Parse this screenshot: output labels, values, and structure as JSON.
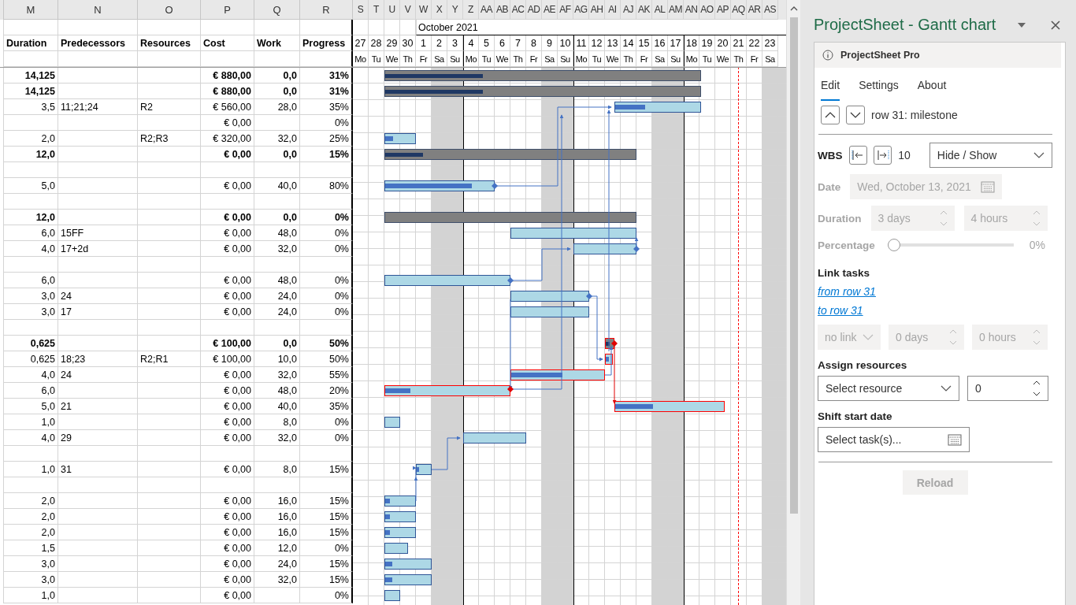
{
  "sheet": {
    "column_letters": [
      "M",
      "N",
      "O",
      "P",
      "Q",
      "R",
      "S",
      "T",
      "U",
      "V",
      "W",
      "X",
      "Y",
      "Z",
      "AA",
      "AB",
      "AC",
      "AD",
      "AE",
      "AF",
      "AG",
      "AH",
      "AI",
      "AJ",
      "AK",
      "AL",
      "AM",
      "AN",
      "AO",
      "AP",
      "AQ",
      "AR",
      "AS"
    ],
    "headers": [
      "Duration",
      "Predecessors",
      "Resources",
      "Cost",
      "Work",
      "Progress"
    ],
    "month": "October 2021",
    "days": [
      {
        "number": "27",
        "weekday": "Mo",
        "weekend": false,
        "today": false
      },
      {
        "number": "28",
        "weekday": "Tu",
        "weekend": false,
        "today": false
      },
      {
        "number": "29",
        "weekday": "We",
        "weekend": false,
        "today": false
      },
      {
        "number": "30",
        "weekday": "Th",
        "weekend": false,
        "today": false
      },
      {
        "number": "1",
        "weekday": "Fr",
        "weekend": false,
        "today": false
      },
      {
        "number": "2",
        "weekday": "Sa",
        "weekend": true,
        "today": false
      },
      {
        "number": "3",
        "weekday": "Su",
        "weekend": true,
        "today": false
      },
      {
        "number": "4",
        "weekday": "Mo",
        "weekend": false,
        "today": false
      },
      {
        "number": "5",
        "weekday": "Tu",
        "weekend": false,
        "today": false
      },
      {
        "number": "6",
        "weekday": "We",
        "weekend": false,
        "today": false
      },
      {
        "number": "7",
        "weekday": "Th",
        "weekend": false,
        "today": false
      },
      {
        "number": "8",
        "weekday": "Fr",
        "weekend": false,
        "today": false
      },
      {
        "number": "9",
        "weekday": "Sa",
        "weekend": true,
        "today": false
      },
      {
        "number": "10",
        "weekday": "Su",
        "weekend": true,
        "today": false
      },
      {
        "number": "11",
        "weekday": "Mo",
        "weekend": false,
        "today": false
      },
      {
        "number": "12",
        "weekday": "Tu",
        "weekend": false,
        "today": false
      },
      {
        "number": "13",
        "weekday": "We",
        "weekend": false,
        "today": false
      },
      {
        "number": "14",
        "weekday": "Th",
        "weekend": false,
        "today": false
      },
      {
        "number": "15",
        "weekday": "Fr",
        "weekend": false,
        "today": false
      },
      {
        "number": "16",
        "weekday": "Sa",
        "weekend": true,
        "today": false
      },
      {
        "number": "17",
        "weekday": "Su",
        "weekend": true,
        "today": false
      },
      {
        "number": "18",
        "weekday": "Mo",
        "weekend": false,
        "today": false
      },
      {
        "number": "19",
        "weekday": "Tu",
        "weekend": false,
        "today": false
      },
      {
        "number": "20",
        "weekday": "We",
        "weekend": false,
        "today": false
      },
      {
        "number": "21",
        "weekday": "Th",
        "weekend": false,
        "today": true
      },
      {
        "number": "22",
        "weekday": "Fr",
        "weekend": false,
        "today": false
      },
      {
        "number": "23",
        "weekday": "Sa",
        "weekend": true,
        "today": false
      }
    ],
    "rows": [
      {
        "duration": "14,125",
        "cost": "€ 880,00",
        "work": "0,0",
        "progress": "31%",
        "bold": true,
        "bar": {
          "kind": "summary",
          "level": 0.31
        }
      },
      {
        "duration": "14,125",
        "cost": "€ 880,00",
        "work": "0,0",
        "progress": "31%",
        "bold": true,
        "bar": {
          "kind": "summary",
          "level": 0.31
        }
      },
      {
        "duration": "3,5",
        "predecessors": "11;21;24",
        "resources": "R2",
        "cost": "€ 560,00",
        "work": "28,0",
        "progress": "35%",
        "bold": false,
        "bar": {
          "kind": "task",
          "level": 0.35
        }
      },
      {
        "cost": "€ 0,00",
        "progress": "0%",
        "bold": false
      },
      {
        "duration": "2,0",
        "resources": "R2;R3",
        "cost": "€ 320,00",
        "work": "32,0",
        "progress": "25%",
        "bold": false,
        "bar": {
          "kind": "task",
          "level": 0.25
        }
      },
      {
        "duration": "12,0",
        "cost": "€ 0,00",
        "work": "0,0",
        "progress": "15%",
        "bold": true,
        "bar": {
          "kind": "summary",
          "level": 0.15
        }
      },
      {},
      {
        "duration": "5,0",
        "cost": "€ 0,00",
        "work": "40,0",
        "progress": "80%",
        "bold": false,
        "bar": {
          "kind": "task",
          "level": 0.8
        }
      },
      {},
      {
        "duration": "12,0",
        "cost": "€ 0,00",
        "work": "0,0",
        "progress": "0%",
        "bold": true,
        "bar": {
          "kind": "summary",
          "level": 0
        }
      },
      {
        "duration": "6,0",
        "predecessors": "15FF",
        "cost": "€ 0,00",
        "work": "48,0",
        "progress": "0%",
        "bold": false,
        "bar": {
          "kind": "task",
          "level": 0
        }
      },
      {
        "duration": "4,0",
        "predecessors": "17+2d",
        "cost": "€ 0,00",
        "work": "32,0",
        "progress": "0%",
        "bold": false,
        "bar": {
          "kind": "task",
          "level": 0
        }
      },
      {},
      {
        "duration": "6,0",
        "cost": "€ 0,00",
        "work": "48,0",
        "progress": "0%",
        "bold": false,
        "bar": {
          "kind": "task",
          "level": 0
        }
      },
      {
        "duration": "3,0",
        "predecessors": "24",
        "cost": "€ 0,00",
        "work": "24,0",
        "progress": "0%",
        "bold": false,
        "bar": {
          "kind": "task",
          "level": 0
        }
      },
      {
        "duration": "3,0",
        "predecessors": "17",
        "cost": "€ 0,00",
        "work": "24,0",
        "progress": "0%",
        "bold": false,
        "bar": {
          "kind": "task",
          "level": 0
        }
      },
      {},
      {
        "duration": "0,625",
        "cost": "€ 100,00",
        "work": "0,0",
        "progress": "50%",
        "bold": true,
        "bar": {
          "kind": "critical-summary",
          "level": 0.5
        }
      },
      {
        "duration": "0,625",
        "predecessors": "18;23",
        "resources": "R2;R1",
        "cost": "€ 100,00",
        "work": "10,0",
        "progress": "50%",
        "bold": false,
        "bar": {
          "kind": "critical",
          "level": 0.5
        }
      },
      {
        "duration": "4,0",
        "predecessors": "24",
        "cost": "€ 0,00",
        "work": "32,0",
        "progress": "55%",
        "bold": false,
        "bar": {
          "kind": "critical",
          "level": 0.55
        }
      },
      {
        "duration": "6,0",
        "cost": "€ 0,00",
        "work": "48,0",
        "progress": "20%",
        "bold": false,
        "bar": {
          "kind": "critical",
          "level": 0.2
        }
      },
      {
        "duration": "5,0",
        "predecessors": "21",
        "cost": "€ 0,00",
        "work": "40,0",
        "progress": "35%",
        "bold": false,
        "bar": {
          "kind": "critical",
          "level": 0.35
        }
      },
      {
        "duration": "1,0",
        "cost": "€ 0,00",
        "work": "8,0",
        "progress": "0%",
        "bold": false,
        "bar": {
          "kind": "task",
          "level": 0
        }
      },
      {
        "duration": "4,0",
        "predecessors": "29",
        "cost": "€ 0,00",
        "work": "32,0",
        "progress": "0%",
        "bold": false,
        "bar": {
          "kind": "task",
          "level": 0
        }
      },
      {},
      {
        "duration": "1,0",
        "predecessors": "31",
        "cost": "€ 0,00",
        "work": "8,0",
        "progress": "15%",
        "bold": false,
        "bar": {
          "kind": "task",
          "level": 0.15
        }
      },
      {},
      {
        "duration": "2,0",
        "cost": "€ 0,00",
        "work": "16,0",
        "progress": "15%",
        "bold": false,
        "bar": {
          "kind": "task",
          "level": 0.15
        }
      },
      {
        "duration": "2,0",
        "cost": "€ 0,00",
        "work": "16,0",
        "progress": "15%",
        "bold": false,
        "bar": {
          "kind": "task",
          "level": 0.15
        }
      },
      {
        "duration": "2,0",
        "cost": "€ 0,00",
        "work": "16,0",
        "progress": "15%",
        "bold": false,
        "bar": {
          "kind": "task",
          "level": 0.15
        }
      },
      {
        "duration": "1,5",
        "cost": "€ 0,00",
        "work": "12,0",
        "progress": "0%",
        "bold": false,
        "bar": {
          "kind": "task",
          "level": 0
        }
      },
      {
        "duration": "3,0",
        "cost": "€ 0,00",
        "work": "24,0",
        "progress": "15%",
        "bold": false,
        "bar": {
          "kind": "task",
          "level": 0.15
        }
      },
      {
        "duration": "3,0",
        "cost": "€ 0,00",
        "work": "32,0",
        "progress": "15%",
        "bold": false,
        "bar": {
          "kind": "task",
          "level": 0.15
        }
      },
      {
        "duration": "1,0",
        "cost": "€ 0,00",
        "progress": "0%",
        "bold": false,
        "bar": {
          "kind": "task",
          "level": 0
        }
      }
    ]
  },
  "pane": {
    "title": "ProjectSheet - Gantt chart",
    "banner": "ProjectSheet Pro",
    "tabs": [
      {
        "label": "Edit",
        "selected": true
      },
      {
        "label": "Settings",
        "selected": false
      },
      {
        "label": "About",
        "selected": false
      }
    ],
    "current_row": "row 31: milestone",
    "wbs": {
      "label": "WBS",
      "value": "10",
      "visibility": "Hide / Show"
    },
    "date": {
      "label": "Date",
      "value": "Wed, October 13, 2021",
      "disabled": true
    },
    "duration": {
      "label": "Duration",
      "days": "3 days",
      "hours": "4 hours",
      "disabled": true
    },
    "percentage": {
      "label": "Percentage",
      "level": 0,
      "reading": "0%",
      "disabled": true
    },
    "link_tasks": {
      "heading": "Link tasks",
      "links": [
        "from row 31",
        "to row 31"
      ],
      "type": "no link",
      "lag_days": "0 days",
      "lag_hours": "0 hours",
      "disabled": true
    },
    "resources": {
      "heading": "Assign resources",
      "placeholder": "Select resource",
      "units": "0"
    },
    "shift": {
      "heading": "Shift start date",
      "placeholder": "Select task(s)..."
    },
    "reload": {
      "label": "Reload",
      "disabled": true
    }
  }
}
